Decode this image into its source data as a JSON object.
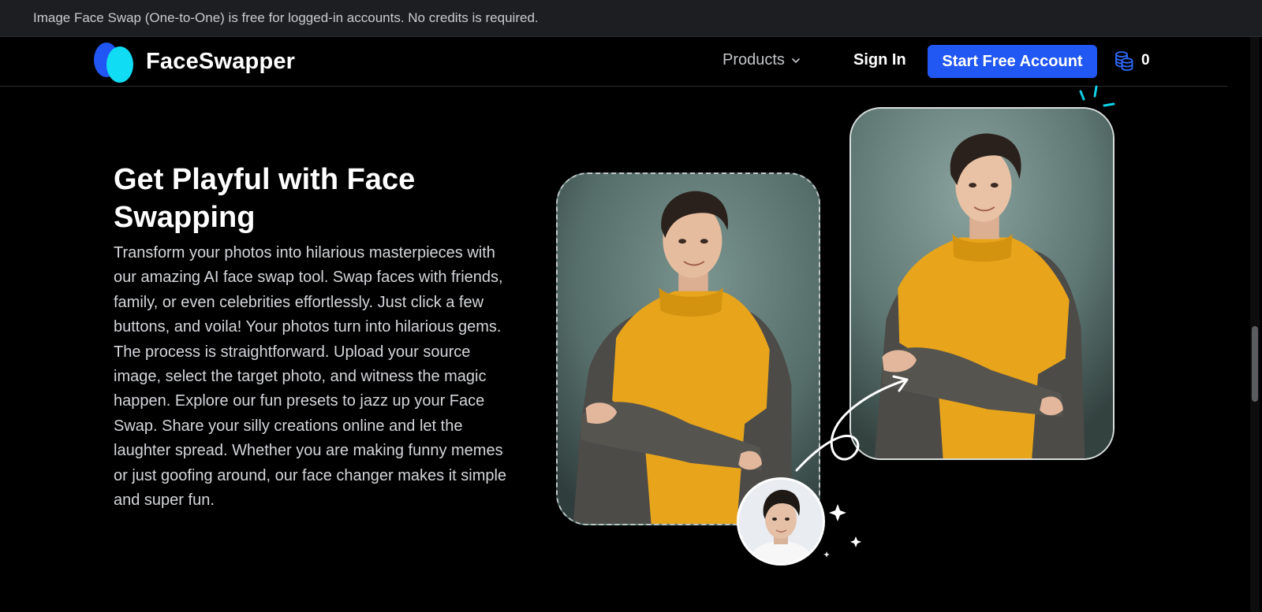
{
  "announcement": "Image Face Swap (One-to-One) is free for logged-in accounts. No credits is required.",
  "brand": {
    "name": "FaceSwapper",
    "colors": {
      "primary": "#2157f3",
      "accent": "#10dcf4"
    }
  },
  "nav": {
    "products_label": "Products",
    "signin_label": "Sign In",
    "cta_label": "Start Free Account",
    "credits_count": "0",
    "credits_icon": "coins-stack-icon"
  },
  "hero": {
    "title": "Get Playful with Face Swapping",
    "description": "Transform your photos into hilarious masterpieces with our amazing AI face swap tool. Swap faces with friends, family, or even celebrities effortlessly. Just click a few buttons, and voila! Your photos turn into hilarious gems. The process is straightforward. Upload your source image, select the target photo, and witness the magic happen. Explore our fun presets to jazz up your Face Swap. Share your silly creations online and let the laughter spread. Whether you are making funny memes or just goofing around, our face changer makes it simple and super fun."
  }
}
